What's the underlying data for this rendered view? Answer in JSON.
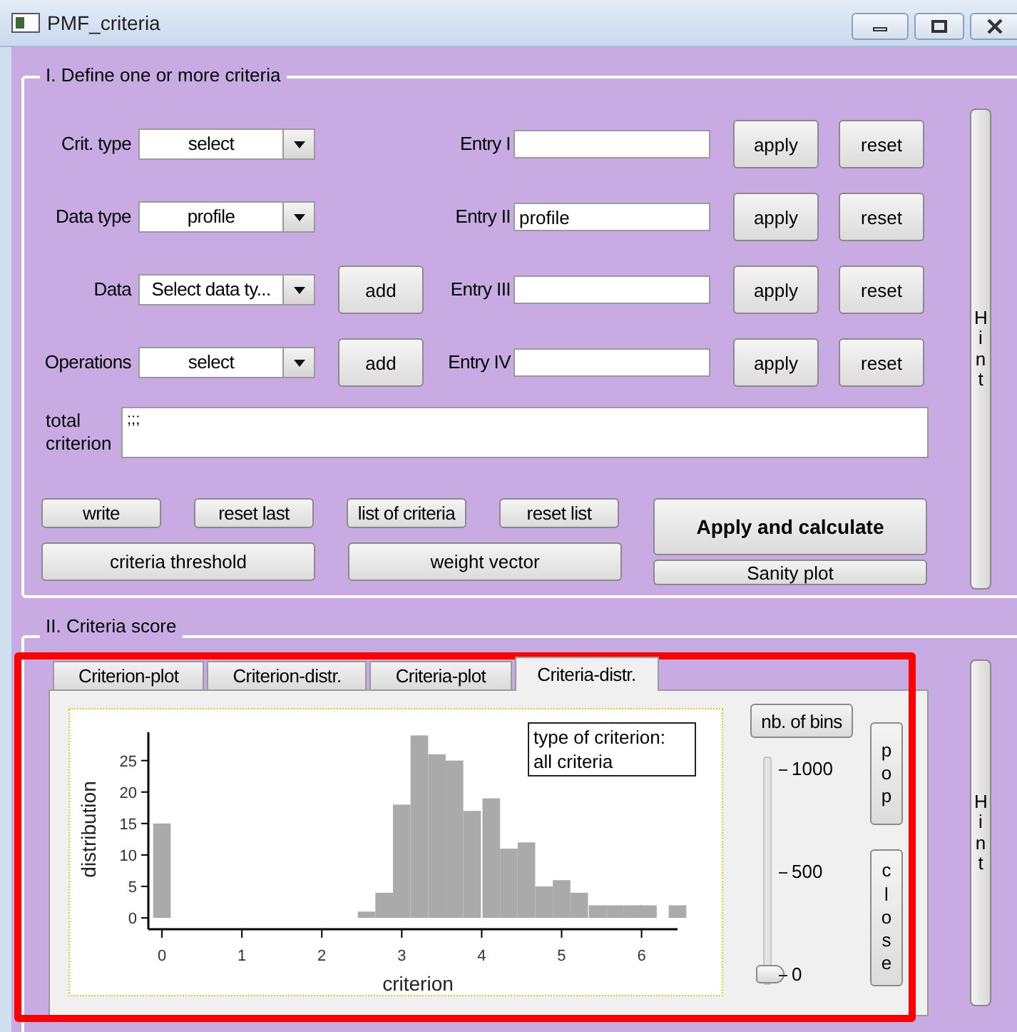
{
  "window": {
    "title": "PMF_criteria"
  },
  "define_section": {
    "title": "I. Define one or more criteria",
    "rows": [
      {
        "label": "Crit. type",
        "dropdown": "select",
        "entry_label": "Entry I",
        "apply": "apply",
        "reset": "reset"
      },
      {
        "label": "Data type",
        "dropdown": "profile",
        "entry_label": "Entry II",
        "entry_value": "profile",
        "apply": "apply",
        "reset": "reset"
      },
      {
        "label": "Data",
        "dropdown": "Select data ty...",
        "add": "add",
        "entry_label": "Entry III",
        "apply": "apply",
        "reset": "reset"
      },
      {
        "label": "Operations",
        "dropdown": "select",
        "add": "add",
        "entry_label": "Entry IV",
        "apply": "apply",
        "reset": "reset"
      }
    ],
    "total_criterion": {
      "label": "total criterion",
      "value": ";;;"
    },
    "small_buttons": [
      "write",
      "reset last",
      "list of criteria",
      "reset list"
    ],
    "wide_buttons": [
      "criteria threshold",
      "weight vector"
    ],
    "calculate_button": "Apply and calculate",
    "sanity_button": "Sanity plot",
    "hint": "Hint"
  },
  "score_section": {
    "title": "II. Criteria score",
    "tabs": [
      {
        "label": "Criterion-plot",
        "selected": false
      },
      {
        "label": "Criterion-distr.",
        "selected": false
      },
      {
        "label": "Criteria-plot",
        "selected": false
      },
      {
        "label": "Criteria-distr.",
        "selected": true
      }
    ],
    "chart_data": {
      "type": "bar",
      "xlabel": "criterion",
      "ylabel": "distribution",
      "x": [
        0,
        2.56,
        2.78,
        3.0,
        3.22,
        3.44,
        3.66,
        3.88,
        4.12,
        4.34,
        4.56,
        4.78,
        5.0,
        5.22,
        5.45,
        5.67,
        5.89,
        6.08,
        6.45
      ],
      "values": [
        15,
        1,
        4,
        18,
        29,
        26,
        25,
        17,
        19,
        11,
        12,
        5,
        6,
        4,
        2,
        2,
        2,
        2,
        2
      ],
      "xlim": [
        -0.17,
        6.45
      ],
      "ylim": [
        -1.8,
        29.5
      ],
      "xticks": [
        0,
        1,
        2,
        3,
        4,
        5,
        6
      ],
      "yticks": [
        0,
        5,
        10,
        15,
        20,
        25
      ],
      "annotations": [
        {
          "text": "type of criterion:\nall criteria"
        }
      ]
    },
    "bins_button": "nb. of bins",
    "slider": {
      "level": 0,
      "ticks": [
        "1000",
        "500",
        "0"
      ]
    },
    "pop_button": "pop",
    "close_button": "close",
    "hint": "Hint"
  }
}
